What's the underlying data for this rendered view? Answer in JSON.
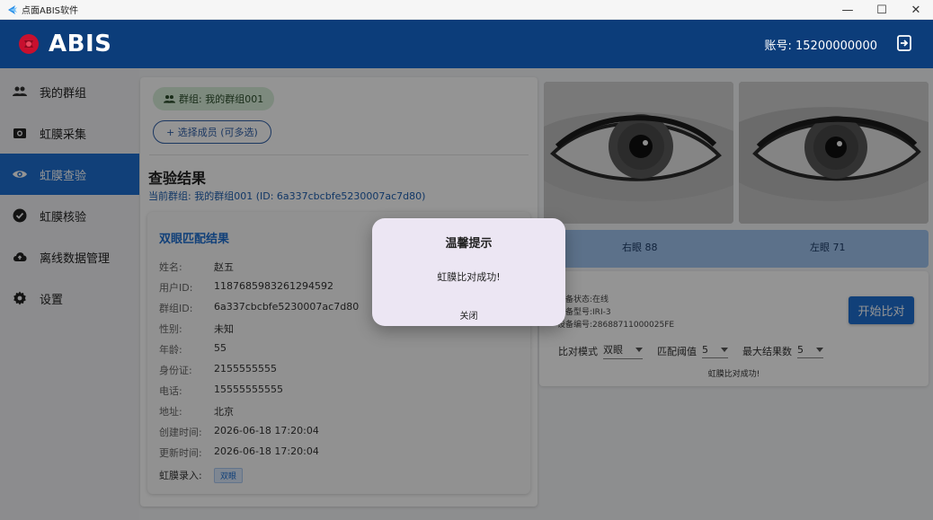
{
  "window": {
    "title": "点面ABIS软件",
    "minimize": "—",
    "maximize": "☐",
    "close": "✕"
  },
  "header": {
    "brand": "ABIS",
    "account": "账号: 15200000000"
  },
  "sidebar": {
    "items": [
      {
        "label": "我的群组",
        "icon": "group-icon"
      },
      {
        "label": "虹膜采集",
        "icon": "camera-icon"
      },
      {
        "label": "虹膜查验",
        "icon": "eye-icon",
        "active": true
      },
      {
        "label": "虹膜核验",
        "icon": "check-circle-icon"
      },
      {
        "label": "离线数据管理",
        "icon": "cloud-upload-icon"
      },
      {
        "label": "设置",
        "icon": "gear-icon"
      }
    ]
  },
  "main": {
    "group_chip": "群组: 我的群组001",
    "select_members": "+  选择成员 (可多选)",
    "section_title": "查验结果",
    "current_group": "当前群组: 我的群组001 (ID: 6a337cbcbfe5230007ac7d80)",
    "card_title": "双眼匹配结果",
    "fields": [
      {
        "k": "姓名:",
        "v": "赵五"
      },
      {
        "k": "用户ID:",
        "v": "1187685983261294592"
      },
      {
        "k": "群组ID:",
        "v": "6a337cbcbfe5230007ac7d80"
      },
      {
        "k": "性别:",
        "v": "未知"
      },
      {
        "k": "年龄:",
        "v": "55"
      },
      {
        "k": "身份证:",
        "v": "2155555555"
      },
      {
        "k": "电话:",
        "v": "15555555555"
      },
      {
        "k": "地址:",
        "v": "北京"
      },
      {
        "k": "创建时间:",
        "v": "2026-06-18 17:20:04"
      },
      {
        "k": "更新时间:",
        "v": "2026-06-18 17:20:04"
      }
    ],
    "iris_entry_label": "虹膜录入:",
    "iris_entry_tag": "双眼"
  },
  "right": {
    "right_eye_score": "右眼 88",
    "left_eye_score": "左眼 71",
    "device_status": "设备状态:在线",
    "device_model": "设备型号:IRI-3",
    "device_serial": "设备编号:28688711000025FE",
    "start_button": "开始比对",
    "compare_mode_label": "比对模式",
    "compare_mode_value": "双眼",
    "threshold_label": "匹配阈值",
    "threshold_value": "5",
    "max_results_label": "最大结果数",
    "max_results_value": "5",
    "status_message": "虹膜比对成功!"
  },
  "dialog": {
    "title": "温馨提示",
    "message": "虹膜比对成功!",
    "close": "关闭"
  },
  "colors": {
    "header_bg": "#0c3d7a",
    "accent": "#1e6fd1",
    "chip_bg": "#d7eed9"
  }
}
